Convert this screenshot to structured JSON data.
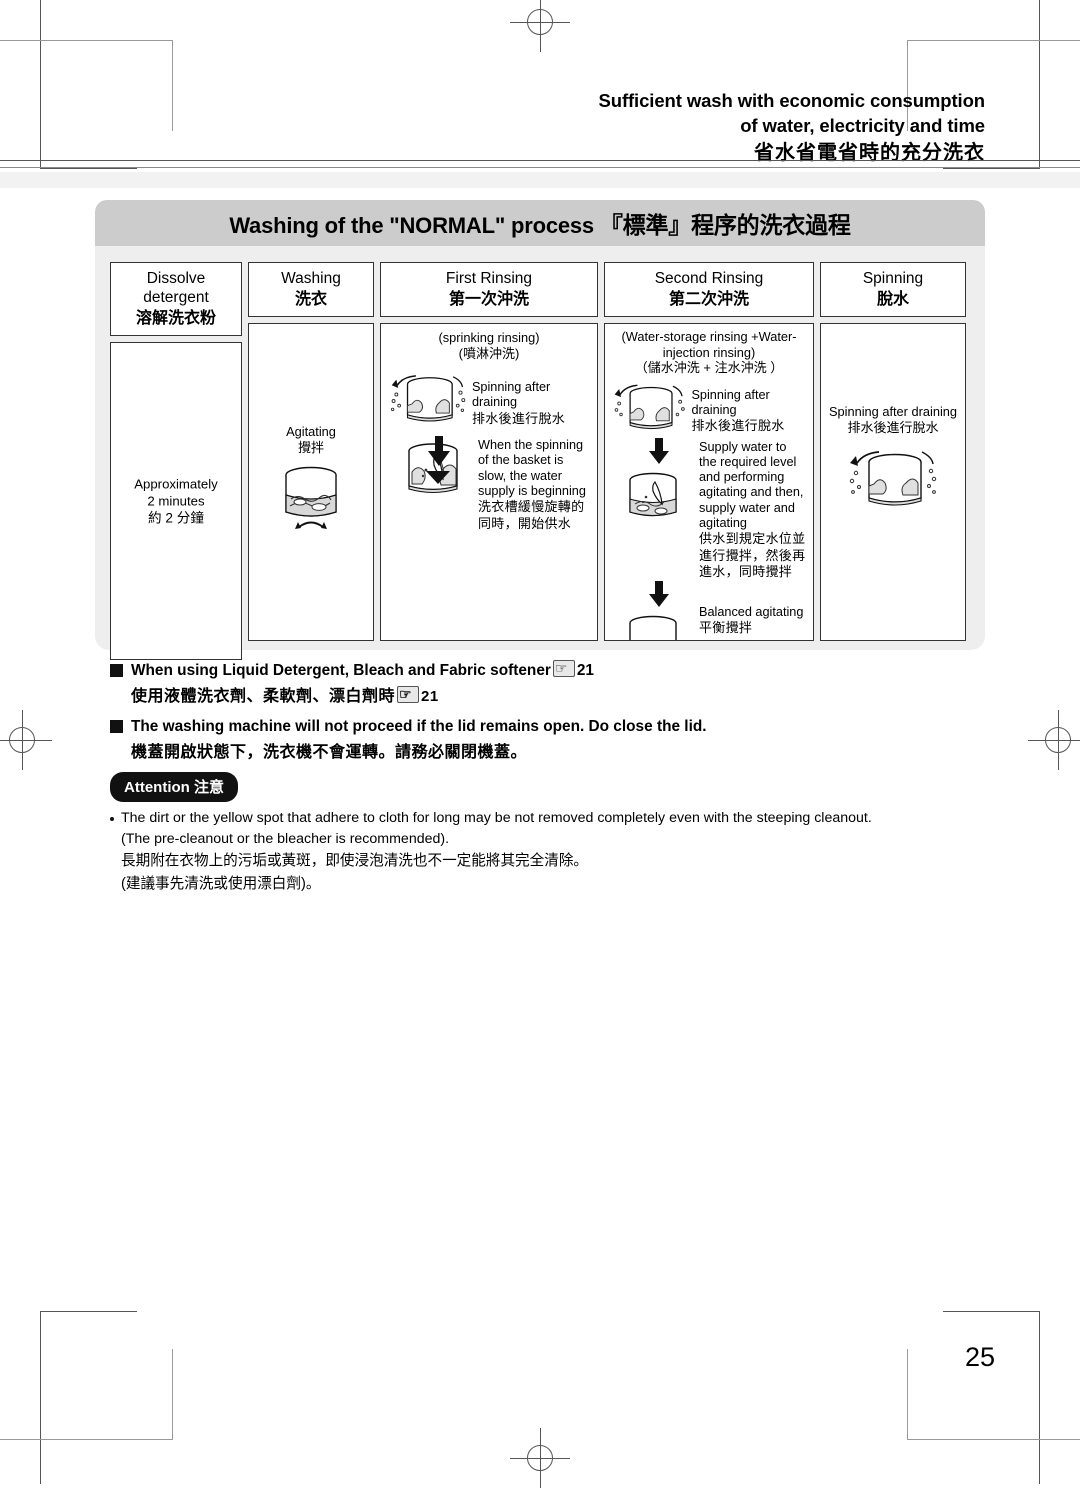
{
  "header": {
    "line1": "Sufficient wash with economic consumption",
    "line2": "of water, electricity and time",
    "line_zh": "省水省電省時的充分洗衣"
  },
  "banner": {
    "title_en": "Washing of the \"NORMAL\" process ",
    "title_zh": "『標準』程序的洗衣過程"
  },
  "process": {
    "columns": [
      {
        "head_en": "Dissolve detergent",
        "head_zh": "溶解洗衣粉",
        "center_en_1": "Approximately",
        "center_en_2": "2 minutes",
        "center_zh": "約 2 分鐘"
      },
      {
        "head_en": "Washing",
        "head_zh": "洗衣",
        "cap_en": "Agitating",
        "cap_zh": "攪拌"
      },
      {
        "head_en": "First Rinsing",
        "head_zh": "第一次沖洗",
        "cap_en": "(sprinking rinsing)",
        "cap_zh": "(噴淋沖洗)",
        "step1_en": "Spinning after draining",
        "step1_zh": "排水後進行脫水",
        "step2_en": "When the spinning of the basket is slow, the water supply is beginning",
        "step2_zh": "洗衣槽緩慢旋轉的同時，開始供水"
      },
      {
        "head_en": "Second Rinsing",
        "head_zh": "第二次沖洗",
        "cap_en_1": "(Water-storage rinsing +Water-",
        "cap_en_2": "injection rinsing)",
        "cap_zh": "（儲水沖洗 + 注水沖洗 ）",
        "step1_en": "Spinning after draining",
        "step1_zh": "排水後進行脫水",
        "step2_en": "Supply water to the required level and performing agitating and then, supply water and agitating",
        "step2_zh": "供水到規定水位並進行攪拌，然後再進水，同時攪拌",
        "step3_en": "Balanced agitating",
        "step3_zh": "平衡攪拌"
      },
      {
        "head_en": "Spinning",
        "head_zh": "脫水",
        "cap_en": "Spinning after draining",
        "cap_zh": "排水後進行脫水"
      }
    ]
  },
  "bullets": [
    {
      "en_before": "When using Liquid Detergent, Bleach and Fabric softener",
      "ref": "21",
      "zh_before": "使用液體洗衣劑、柔軟劑、漂白劑時",
      "zh_ref": "21"
    },
    {
      "en_before": "The washing machine will not proceed if the lid remains open. Do close the lid.",
      "zh_before": "機蓋開啟狀態下，洗衣機不會運轉。請務必關閉機蓋。"
    }
  ],
  "attention": {
    "label_en": "Attention ",
    "label_zh": "注意",
    "line1": "The dirt or the yellow spot that adhere to cloth for long may be not removed completely even with the steeping cleanout.",
    "line2": "(The pre-cleanout or the bleacher is recommended).",
    "line3": "長期附在衣物上的污垢或黃斑，即使浸泡清洗也不一定能將其完全清除。",
    "line4": "(建議事先清洗或使用漂白劑)。"
  },
  "page_number": "25"
}
